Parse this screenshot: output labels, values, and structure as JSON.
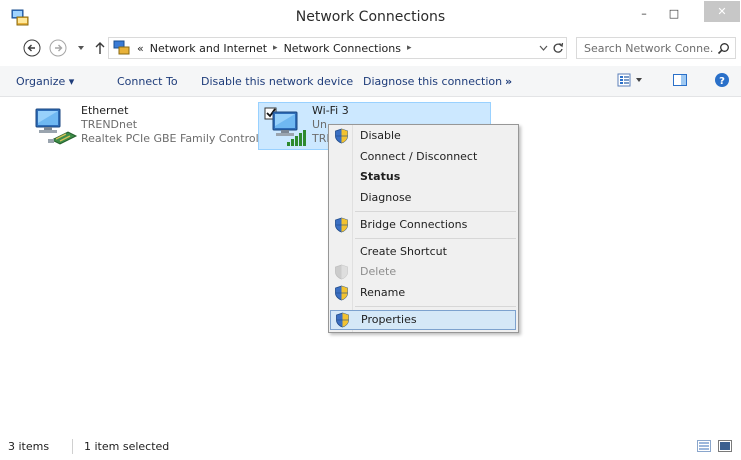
{
  "window": {
    "title": "Network Connections",
    "minimize": "–",
    "maximize": "□",
    "close": "✕"
  },
  "address": {
    "prefix": "«",
    "crumbs": [
      "Network and Internet",
      "Network Connections"
    ],
    "search_placeholder": "Search Network Conne..."
  },
  "toolbar": {
    "organize": "Organize ▾",
    "connect_to": "Connect To",
    "disable_device": "Disable this network device",
    "diagnose": "Diagnose this connection",
    "more": "»"
  },
  "items": [
    {
      "name": "Ethernet",
      "line2": "TRENDnet",
      "line3": "Realtek PCIe GBE Family Controller"
    },
    {
      "name": "Wi-Fi 3",
      "line2": "Un",
      "line3": "TRE"
    }
  ],
  "context_menu": {
    "items": [
      "Disable",
      "Connect / Disconnect",
      "Status",
      "Diagnose",
      "Bridge Connections",
      "Create Shortcut",
      "Delete",
      "Rename",
      "Properties"
    ],
    "disabled": [
      "Delete"
    ],
    "bold": [
      "Status"
    ],
    "highlighted": "Properties"
  },
  "status": {
    "count": "3 items",
    "selected": "1 item selected"
  },
  "colors": {
    "selection_bg": "#cce8ff",
    "toolbar_bg": "#f5f6f7",
    "link_text": "#1e3c7a",
    "menu_bg": "#f0f0f0",
    "close_button": "#c7c7c7"
  }
}
